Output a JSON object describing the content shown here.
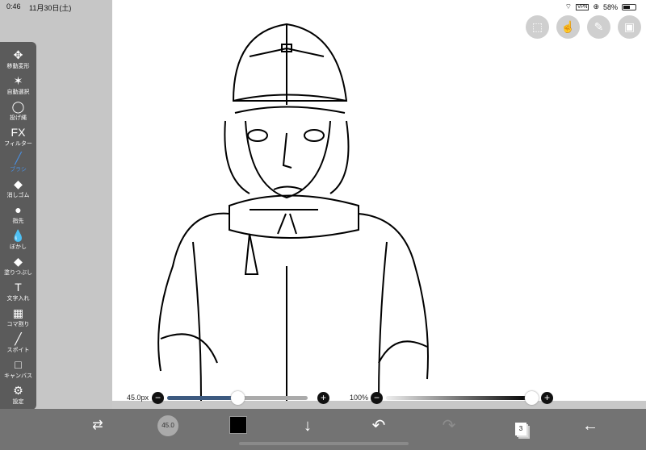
{
  "status": {
    "time": "0:46",
    "date": "11月30日(土)",
    "vpn": "VPN",
    "battery": "58%",
    "battery_level": 0.58
  },
  "tools": [
    {
      "label": "移動変形",
      "icon": "move-icon",
      "glyph": "✥"
    },
    {
      "label": "自動選択",
      "icon": "magic-wand-icon",
      "glyph": "✶"
    },
    {
      "label": "投げ縄",
      "icon": "lasso-icon",
      "glyph": "◯"
    },
    {
      "label": "フィルター",
      "icon": "fx-icon",
      "glyph": "FX"
    },
    {
      "label": "ブラシ",
      "icon": "brush-icon",
      "glyph": "╱",
      "active": true
    },
    {
      "label": "消しゴム",
      "icon": "eraser-icon",
      "glyph": "◆"
    },
    {
      "label": "指先",
      "icon": "smudge-icon",
      "glyph": "●"
    },
    {
      "label": "ぼかし",
      "icon": "blur-drop-icon",
      "glyph": "💧"
    },
    {
      "label": "塗りつぶし",
      "icon": "fill-bucket-icon",
      "glyph": "◆"
    },
    {
      "label": "文字入れ",
      "icon": "text-icon",
      "glyph": "T"
    },
    {
      "label": "コマ割り",
      "icon": "frame-divider-icon",
      "glyph": "▦"
    },
    {
      "label": "スポイト",
      "icon": "eyedropper-icon",
      "glyph": "╱"
    },
    {
      "label": "キャンバス",
      "icon": "canvas-icon",
      "glyph": "□"
    },
    {
      "label": "設定",
      "icon": "gear-icon",
      "glyph": "⚙"
    }
  ],
  "brush": {
    "size_label": "45.0px",
    "size_fraction": 0.5,
    "opacity_label": "100%",
    "opacity_fraction": 1.0,
    "thumb_label": "45.0"
  },
  "colors": {
    "accent": "#4a90e2",
    "slider_fill": "#3d5a80",
    "current_color": "#000000"
  },
  "layers": {
    "count": "3"
  }
}
